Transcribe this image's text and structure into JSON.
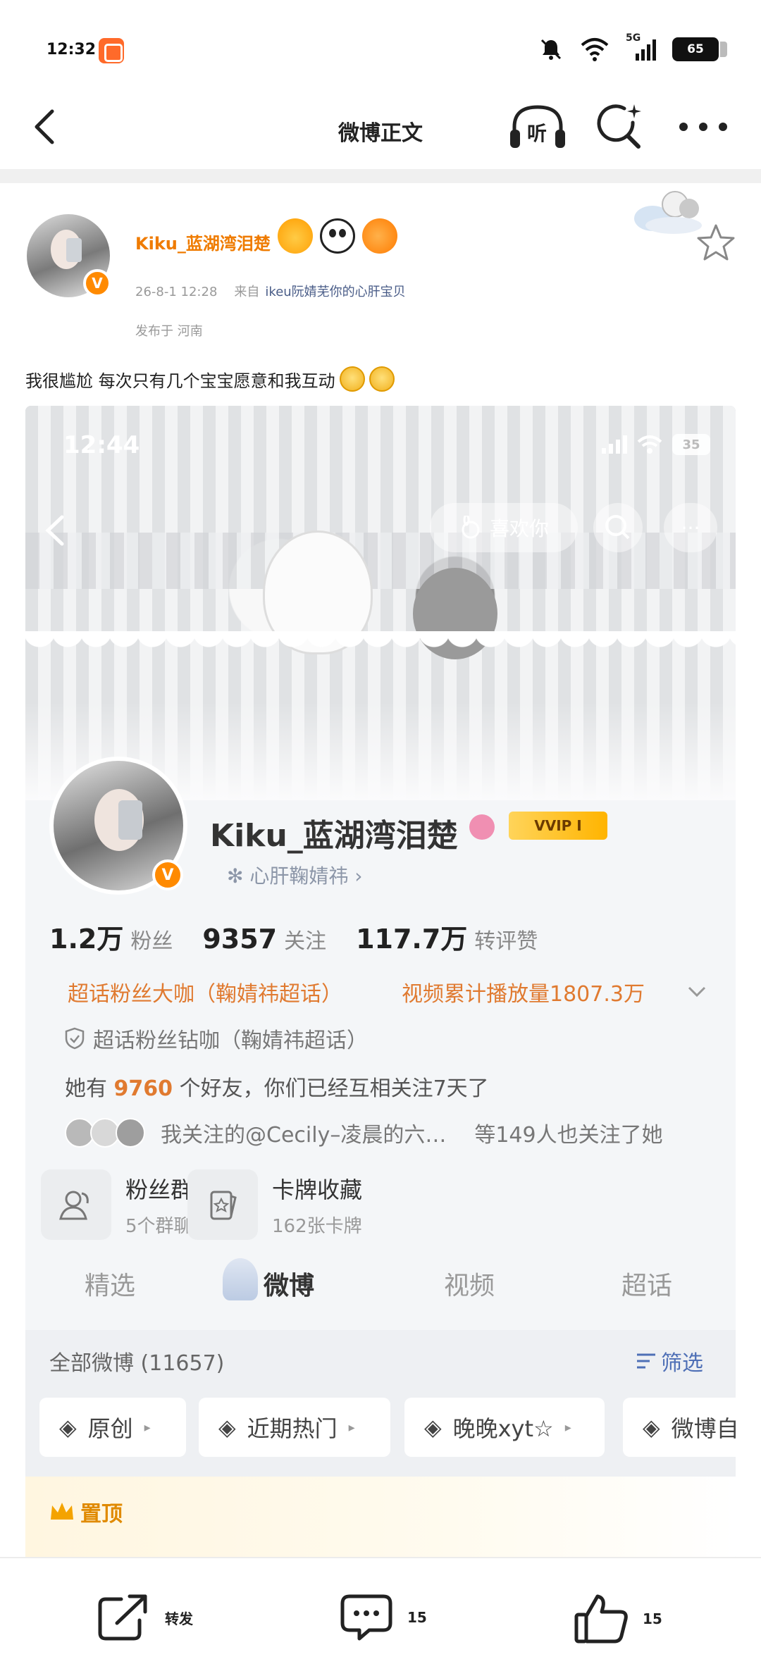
{
  "status_bar": {
    "time": "12:32",
    "network": "5G",
    "battery": "65"
  },
  "nav": {
    "title": "微博正文",
    "listen_label": "听"
  },
  "post": {
    "username": "Kiku_蓝湖湾泪楚",
    "verified_badge": "V",
    "timestamp": "26-8-1 12:28",
    "from_label": "来自",
    "source": "ikeu阮婧芜你的心肝宝贝",
    "location": "发布于 河南",
    "text": "我很尴尬 每次只有几个宝宝愿意和我互动"
  },
  "screenshot": {
    "time": "12:44",
    "battery": "35",
    "like_label": "喜欢你",
    "more_label": "···",
    "username": "Kiku_蓝湖湾泪楚",
    "vvip": "VVIP I",
    "tagline": "心肝鞠婧祎",
    "stats": [
      {
        "num": "1.2万",
        "label": "粉丝"
      },
      {
        "num": "9357",
        "label": "关注"
      },
      {
        "num": "117.7万",
        "label": "转评赞"
      }
    ],
    "super_topic_fan": "超话粉丝大咖（鞠婧祎超话）",
    "video_plays": "视频累计播放量1807.3万",
    "super_topic_diamond": "超话粉丝钻咖（鞠婧祎超话）",
    "friends_prefix": "她有",
    "friends_count": "9760",
    "friends_suffix": "个好友，你们已经互相关注7天了",
    "mutual_text": "我关注的@Cecily–凌晨的六…",
    "mutual_count": "等149人也关注了她",
    "fan_group_title": "粉丝群",
    "fan_group_sub": "5个群聊",
    "cards_title": "卡牌收藏",
    "cards_sub": "162张卡牌",
    "tabs": [
      "精选",
      "微博",
      "视频",
      "超话"
    ],
    "all_weibo": "全部微博 (11657)",
    "filter": "筛选",
    "chips": [
      "原创",
      "近期热门",
      "晚晚xyt☆",
      "微博自"
    ],
    "pinned": "置顶"
  },
  "actions": {
    "repost": "转发",
    "comment_count": "15",
    "like_count": "15"
  },
  "colors": {
    "accent_orange": "#ef7b00",
    "link_blue": "#4a5d88",
    "filter_blue": "#4e6fb6"
  }
}
